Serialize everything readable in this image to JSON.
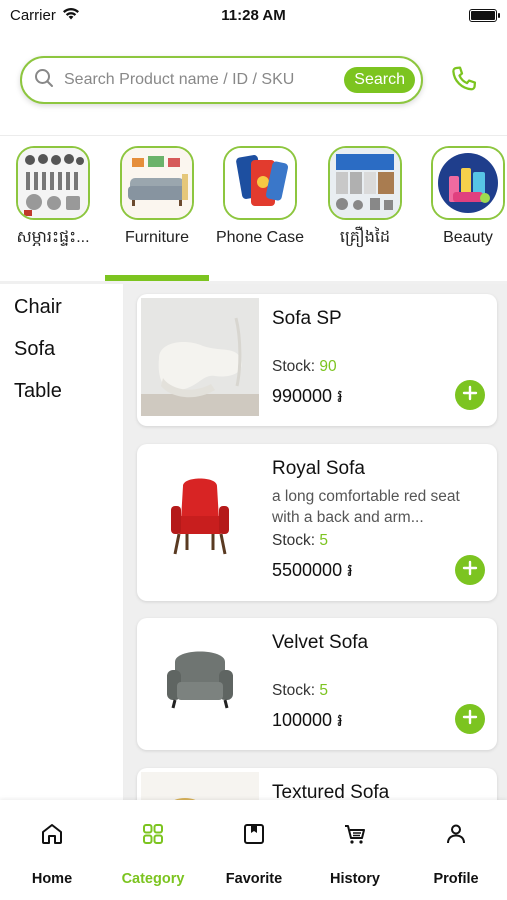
{
  "status_bar": {
    "carrier": "Carrier",
    "time": "11:28 AM"
  },
  "search": {
    "placeholder": "Search Product name / ID / SKU",
    "button_label": "Search"
  },
  "categories": [
    {
      "label": "សម្ភារះផ្ទះ...",
      "icon": "kitchenware-image"
    },
    {
      "label": "Furniture",
      "icon": "sofa-image"
    },
    {
      "label": "Phone Case",
      "icon": "phone-case-image"
    },
    {
      "label": "គ្រឿងដៃ",
      "icon": "hardware-image"
    },
    {
      "label": "Beauty",
      "icon": "cosmetics-image"
    }
  ],
  "selected_category": "Furniture",
  "subcategories": [
    "Chair",
    "Sofa",
    "Table"
  ],
  "products": [
    {
      "name": "Sofa SP",
      "description": "",
      "stock_label": "Stock:",
      "stock": "90",
      "price": "990000 ៛"
    },
    {
      "name": "Royal Sofa",
      "description": "a long comfortable red seat with a back and arm...",
      "stock_label": "Stock:",
      "stock": "5",
      "price": "5500000 ៛"
    },
    {
      "name": "Velvet Sofa",
      "description": "",
      "stock_label": "Stock:",
      "stock": "5",
      "price": "100000 ៛"
    },
    {
      "name": "Textured Sofa",
      "description": "",
      "stock_label": "",
      "stock": "",
      "price": ""
    }
  ],
  "nav": [
    {
      "label": "Home",
      "icon": "home-icon"
    },
    {
      "label": "Category",
      "icon": "grid-icon"
    },
    {
      "label": "Favorite",
      "icon": "bookmark-icon"
    },
    {
      "label": "History",
      "icon": "cart-history-icon"
    },
    {
      "label": "Profile",
      "icon": "user-icon"
    }
  ],
  "colors": {
    "accent": "#7cc420",
    "border": "#8dc63f",
    "background": "#efefef"
  }
}
